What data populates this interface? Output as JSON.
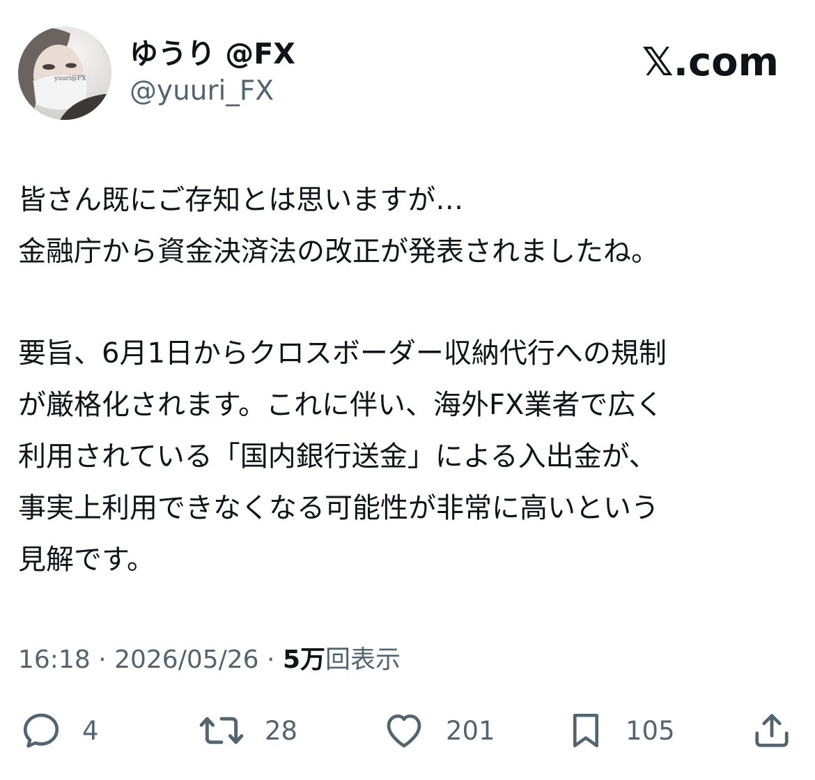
{
  "header": {
    "display_name": "ゆうり @FX",
    "handle": "@yuuri_FX",
    "brand": "𝕏.com",
    "avatar_watermark": "yuuri@FX"
  },
  "tweet": {
    "paragraph1": {
      "line1": "皆さん既にご存知とは思いますが…",
      "line2": "金融庁から資金決済法の改正が発表されましたね。"
    },
    "paragraph2": {
      "line1": "要旨、6月1日からクロスボーダー収納代行への規制",
      "line2": "が厳格化されます。これに伴い、海外FX業者で広く",
      "line3": "利用されている「国内銀行送金」による入出金が、",
      "line4": "事実上利用できなくなる可能性が非常に高いという",
      "line5": "見解です。"
    }
  },
  "meta": {
    "time": "16:18",
    "separator": " · ",
    "date": "2026/05/26",
    "views_count": "5万",
    "views_label": "回表示"
  },
  "actions": {
    "reply_count": "4",
    "retweet_count": "28",
    "like_count": "201",
    "bookmark_count": "105"
  },
  "colors": {
    "text": "#0f1419",
    "secondary": "#536471",
    "background": "#ffffff"
  }
}
